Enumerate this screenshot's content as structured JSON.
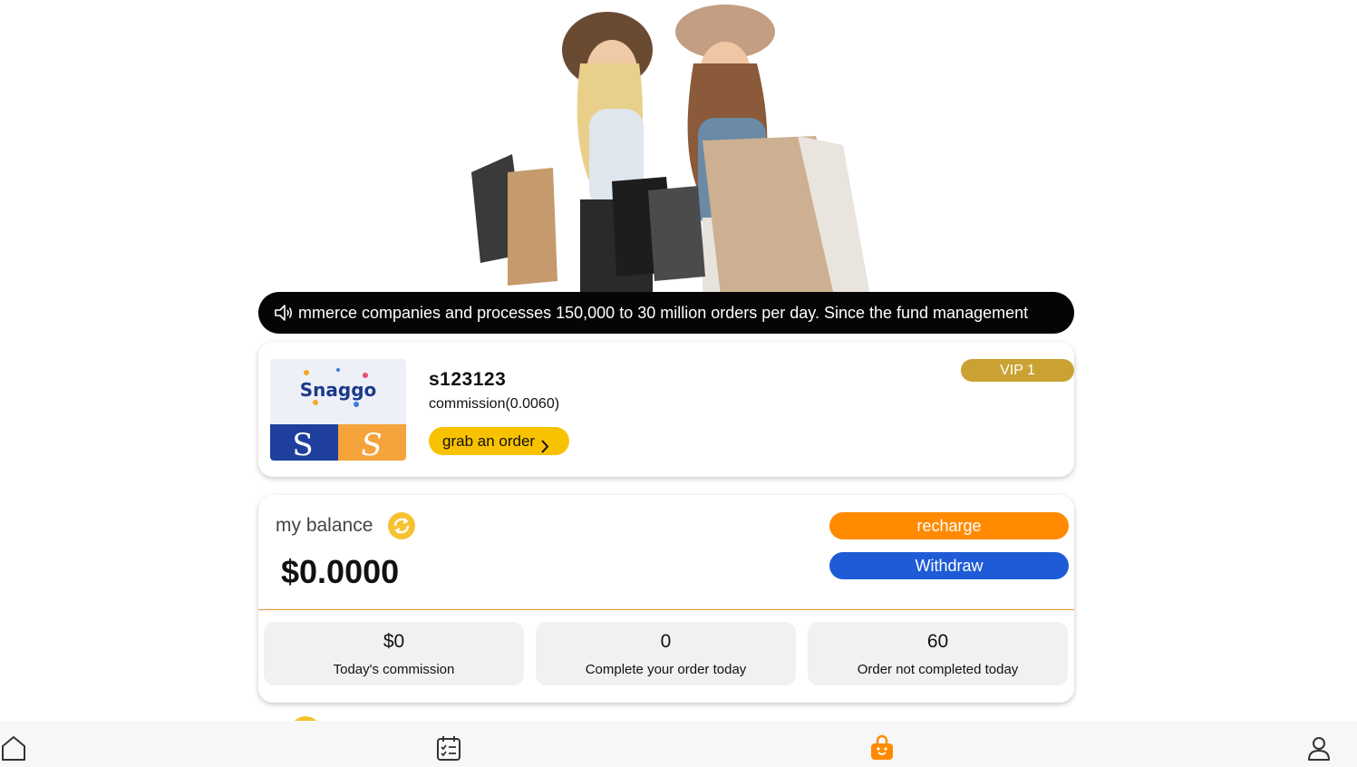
{
  "notice": {
    "text": "mmerce companies and processes 150,000 to 30 million orders per day. Since the fund management",
    "icon": "speaker-icon"
  },
  "user": {
    "logo_text": "Snaggo",
    "username": "s123123",
    "commission_rate": "commission(0.0060)",
    "grab_label": "grab an order",
    "vip": "VIP 1"
  },
  "balance": {
    "label": "my balance",
    "amount": "$0.0000",
    "recharge_label": "recharge",
    "withdraw_label": "Withdraw"
  },
  "stats": [
    {
      "value": "$0",
      "label": "Today's commission"
    },
    {
      "value": "0",
      "label": "Complete your order today"
    },
    {
      "value": "60",
      "label": "Order not completed today"
    }
  ],
  "nav": {
    "items": [
      "home-icon",
      "tasks-icon",
      "shopping-bag-icon",
      "profile-icon"
    ],
    "active": "shopping-bag-icon"
  },
  "colors": {
    "accent_orange": "#ff8a00",
    "withdraw_blue": "#1f5bd6",
    "grab_yellow": "#f9c200",
    "vip_gold": "#c9a233"
  }
}
